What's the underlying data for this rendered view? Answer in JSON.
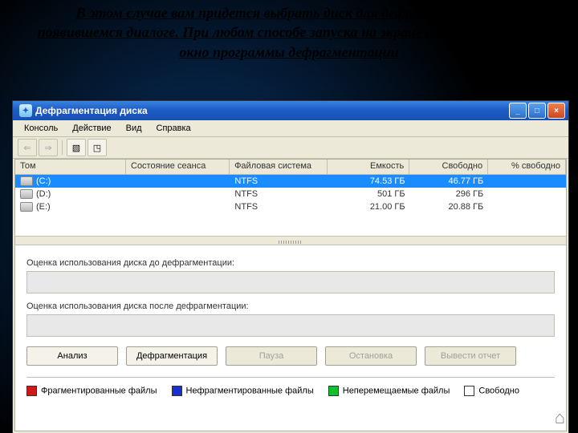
{
  "caption": "В этом случае вам придется выбрать диск для дефрагментации в появившемся диалоге. При любом способе запуска на экране появится рабочее окно программы дефрагментации",
  "window": {
    "title": "Дефрагментация диска"
  },
  "menu": {
    "items": [
      "Консоль",
      "Действие",
      "Вид",
      "Справка"
    ]
  },
  "toolbar": {
    "back": "⇐",
    "forward": "⇒",
    "img1": "▧",
    "img2": "◳"
  },
  "grid": {
    "headers": [
      "Том",
      "Состояние сеанса",
      "Файловая система",
      "Емкость",
      "Свободно",
      "% свободно"
    ],
    "rows": [
      {
        "vol": "(C:)",
        "state": "",
        "fs": "NTFS",
        "cap": "74.53 ГБ",
        "free": "46.77 ГБ",
        "pct": ""
      },
      {
        "vol": "(D:)",
        "state": "",
        "fs": "NTFS",
        "cap": "501 ГБ",
        "free": "296 ГБ",
        "pct": ""
      },
      {
        "vol": "(E:)",
        "state": "",
        "fs": "NTFS",
        "cap": "21.00 ГБ",
        "free": "20.88 ГБ",
        "pct": ""
      }
    ],
    "selected": 0
  },
  "lower": {
    "before_label": "Оценка использования диска до дефрагментации:",
    "after_label": "Оценка использования диска после дефрагментации:"
  },
  "buttons": {
    "analyze": "Анализ",
    "defrag": "Дефрагментация",
    "pause": "Пауза",
    "stop": "Остановка",
    "report": "Вывести отчет"
  },
  "legend": {
    "frag": {
      "label": "Фрагментированные файлы",
      "color": "#d01818"
    },
    "unfrag": {
      "label": "Нефрагментированные файлы",
      "color": "#1830d0"
    },
    "unmov": {
      "label": "Неперемещаемые файлы",
      "color": "#10c030"
    },
    "free": {
      "label": "Свободно",
      "color": "#ffffff"
    }
  }
}
